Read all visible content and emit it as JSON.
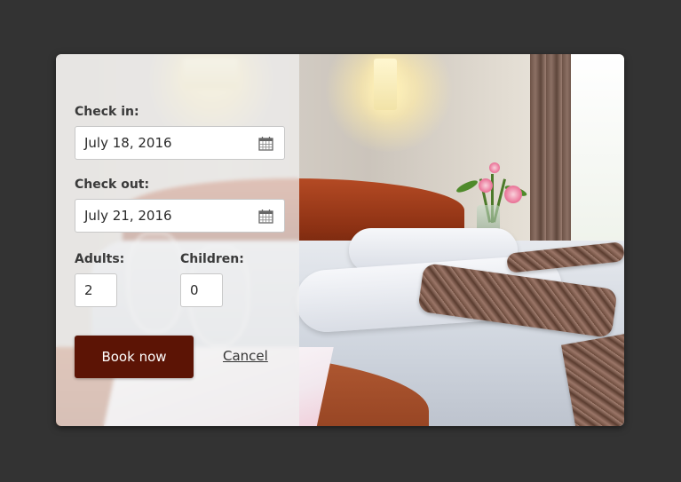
{
  "booking_form": {
    "check_in": {
      "label": "Check in:",
      "value": "July 18, 2016",
      "icon": "calendar-icon"
    },
    "check_out": {
      "label": "Check out:",
      "value": "July 21, 2016",
      "icon": "calendar-icon"
    },
    "adults": {
      "label": "Adults:",
      "value": "2"
    },
    "children": {
      "label": "Children:",
      "value": "0"
    },
    "book_label": "Book now",
    "cancel_label": "Cancel"
  },
  "colors": {
    "page_background": "#333333",
    "book_button": "#5c1405",
    "overlay": "#f0f0f0"
  }
}
